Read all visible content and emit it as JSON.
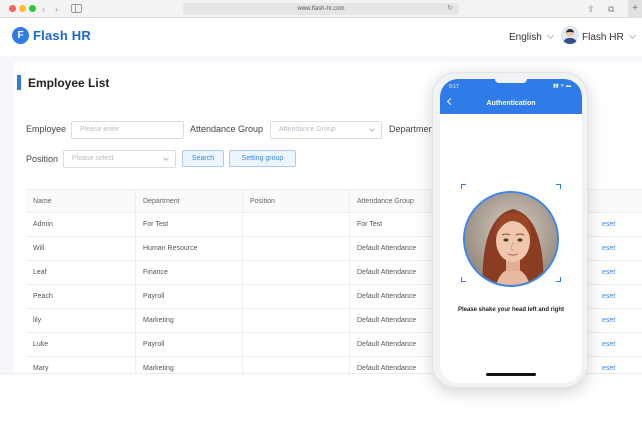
{
  "browser": {
    "url": "www.flash-hr.com",
    "new_tab": "+"
  },
  "header": {
    "logo_mark": "F",
    "logo_text": "Flash HR",
    "language": "English",
    "user_name": "Flash HR"
  },
  "page": {
    "title": "Employee List"
  },
  "filters": {
    "employee_label": "Employee",
    "employee_placeholder": "Please enter",
    "attendance_group_label": "Attendance Group",
    "attendance_group_placeholder": "Attendance Group",
    "department_label": "Department",
    "position_label": "Position",
    "position_placeholder": "Please select",
    "search_button": "Search",
    "setting_group_button": "Setting group"
  },
  "table": {
    "columns": [
      "Name",
      "Department",
      "Position",
      "Attendance Group"
    ],
    "rows": [
      {
        "name": "Admin",
        "department": "For Test",
        "position": "",
        "attendance_group": "For Test",
        "action": "eset"
      },
      {
        "name": "Will",
        "department": "Human Resource",
        "position": "",
        "attendance_group": "Default Attendance",
        "action": "eset"
      },
      {
        "name": "Leaf",
        "department": "Finance",
        "position": "",
        "attendance_group": "Default Attendance",
        "action": "eset"
      },
      {
        "name": "Peach",
        "department": "Payroll",
        "position": "",
        "attendance_group": "Default Attendance",
        "action": "eset"
      },
      {
        "name": "lily",
        "department": "Marketing",
        "position": "",
        "attendance_group": "Default Attendance",
        "action": "eset"
      },
      {
        "name": "Luke",
        "department": "Payroll",
        "position": "",
        "attendance_group": "Default Attendance",
        "action": "eset"
      },
      {
        "name": "Mary",
        "department": "Marketing",
        "position": "",
        "attendance_group": "Default Attendance",
        "action": "eset"
      }
    ]
  },
  "phone": {
    "status_time": "9:17",
    "status_icons": "▮▮ ᯤ ▬",
    "screen_title": "Authentication",
    "instruction": "Please shake your head left and right"
  },
  "colors": {
    "accent": "#2f7ce9",
    "link": "#3c87e6"
  }
}
